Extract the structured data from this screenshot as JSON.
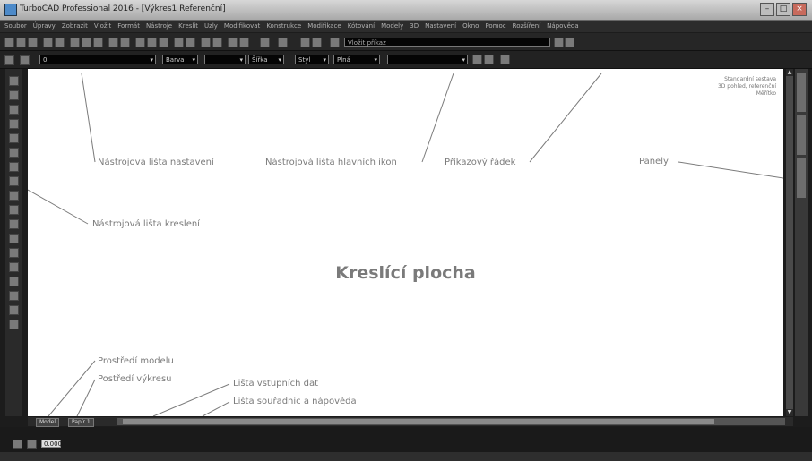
{
  "window": {
    "title": "TurboCAD Professional 2016 - [Výkres1 Referenční]"
  },
  "menu": [
    "Soubor",
    "Úpravy",
    "Zobrazit",
    "Vložit",
    "Formát",
    "Nástroje",
    "Kreslit",
    "Uzly",
    "Modifikovat",
    "Konstrukce",
    "Modifikace",
    "Kótování",
    "Modely",
    "3D",
    "Nastavení",
    "Okno",
    "Pomoc",
    "Rozšíření",
    "Nápověda"
  ],
  "command_line": {
    "value": "Vložit příkaz"
  },
  "toolbar2": {
    "layer": "0",
    "color": "Barva",
    "linetype": "Plná",
    "width": "Šířka",
    "style": "Styl"
  },
  "tabs": {
    "model": "Model",
    "paper": "Papír 1"
  },
  "input": {
    "value": "0.000"
  },
  "ucs": {
    "line1": "Standardní sestava",
    "line2": "3D pohled, referenční",
    "line3": "Měřítko"
  },
  "drawing": {
    "title": "Kreslící plocha",
    "labels": {
      "settings_toolbar": "Nástrojová lišta nastavení",
      "main_icons_toolbar": "Nástrojová lišta hlavních ikon",
      "command_row": "Příkazový řádek",
      "panels": "Panely",
      "draw_toolbar": "Nástrojová lišta kreslení",
      "model_space": "Prostředí modelu",
      "paper_space": "Postředí výkresu",
      "input_bar": "Lišta vstupních dat",
      "coords_help": "Lišta souřadnic a nápověda"
    }
  },
  "colors": {
    "canvas": "#ffffff",
    "chrome": "#262626",
    "label": "#7b7b7b"
  }
}
